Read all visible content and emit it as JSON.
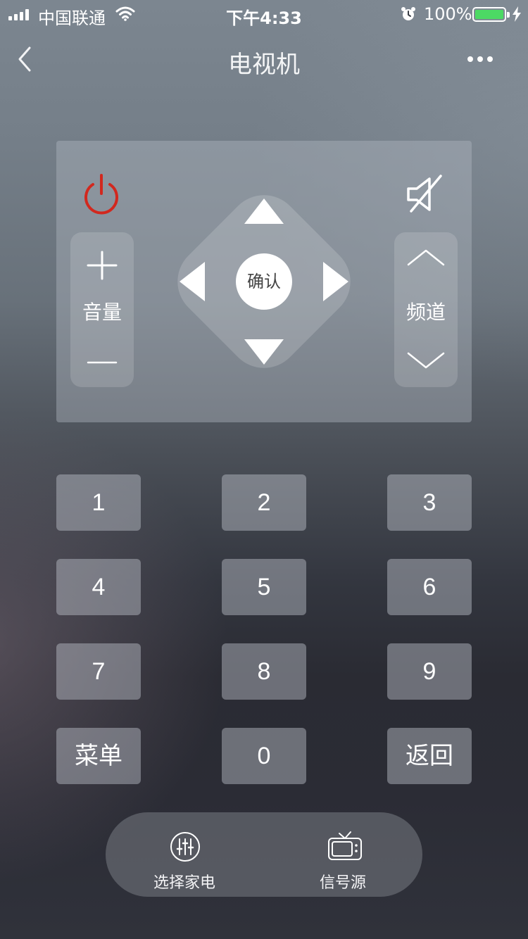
{
  "status_bar": {
    "carrier": "中国联通",
    "time": "下午4:33",
    "battery_percent": "100%",
    "battery_level": 1.0,
    "battery_color": "#4cd964",
    "icons": [
      "signal-icon",
      "wifi-icon",
      "alarm-icon",
      "battery-icon",
      "charging-icon"
    ]
  },
  "nav": {
    "title": "电视机",
    "back_icon": "chevron-left-icon",
    "more_icon": "more-dots-icon"
  },
  "remote": {
    "power_icon": "power-icon",
    "power_color": "#d2281e",
    "mute_icon": "mute-icon",
    "volume_label": "音量",
    "volume_up_icon": "plus-icon",
    "volume_down_icon": "minus-icon",
    "channel_label": "频道",
    "channel_up_icon": "chevron-up-icon",
    "channel_down_icon": "chevron-down-icon",
    "ok_label": "确认",
    "dpad_icons": [
      "arrow-up-icon",
      "arrow-down-icon",
      "arrow-left-icon",
      "arrow-right-icon"
    ]
  },
  "keypad": {
    "keys": [
      "1",
      "2",
      "3",
      "4",
      "5",
      "6",
      "7",
      "8",
      "9",
      "菜单",
      "0",
      "返回"
    ]
  },
  "bottom_bar": {
    "select_appliance": "选择家电",
    "signal_source": "信号源",
    "select_appliance_icon": "equalizer-icon",
    "signal_source_icon": "tv-icon"
  }
}
